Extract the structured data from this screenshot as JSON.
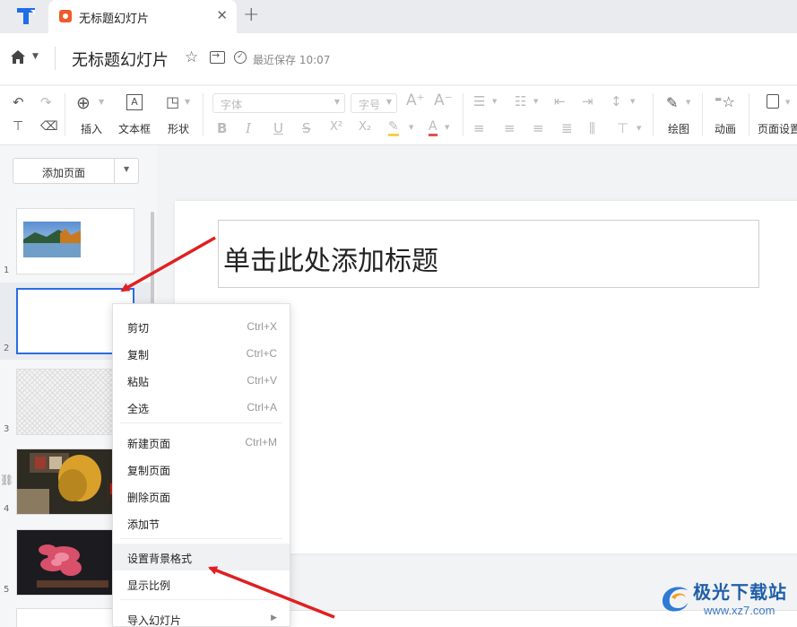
{
  "tabbar": {
    "tab_title": "无标题幻灯片",
    "close_label": "✕",
    "new_tab_label": "+"
  },
  "titlebar": {
    "doc_title": "无标题幻灯片",
    "saved_status": "最近保存 10:07"
  },
  "toolbar": {
    "insert_label": "插入",
    "textbox_label": "文本框",
    "shape_label": "形状",
    "font_placeholder": "字体",
    "size_placeholder": "字号",
    "draw_label": "绘图",
    "animation_label": "动画",
    "page_settings_label": "页面设置"
  },
  "sidebar": {
    "add_page_label": "添加页面",
    "slide_numbers": [
      "1",
      "2",
      "3",
      "4",
      "5"
    ]
  },
  "slide": {
    "title_placeholder": "单击此处添加标题"
  },
  "context_menu": {
    "items": [
      {
        "label": "剪切",
        "shortcut": "Ctrl+X"
      },
      {
        "label": "复制",
        "shortcut": "Ctrl+C"
      },
      {
        "label": "粘贴",
        "shortcut": "Ctrl+V"
      },
      {
        "label": "全选",
        "shortcut": "Ctrl+A"
      },
      {
        "label": "新建页面",
        "shortcut": "Ctrl+M"
      },
      {
        "label": "复制页面",
        "shortcut": ""
      },
      {
        "label": "删除页面",
        "shortcut": ""
      },
      {
        "label": "添加节",
        "shortcut": ""
      },
      {
        "label": "设置背景格式",
        "shortcut": ""
      },
      {
        "label": "显示比例",
        "shortcut": ""
      },
      {
        "label": "导入幻灯片",
        "shortcut": ""
      }
    ]
  },
  "watermark": {
    "brand_text": "极光下载站",
    "url": "www.xz7.com"
  },
  "colors": {
    "accent": "#2b6de5",
    "annotation_arrow": "#e02020",
    "tab_icon": "#f05a28"
  }
}
